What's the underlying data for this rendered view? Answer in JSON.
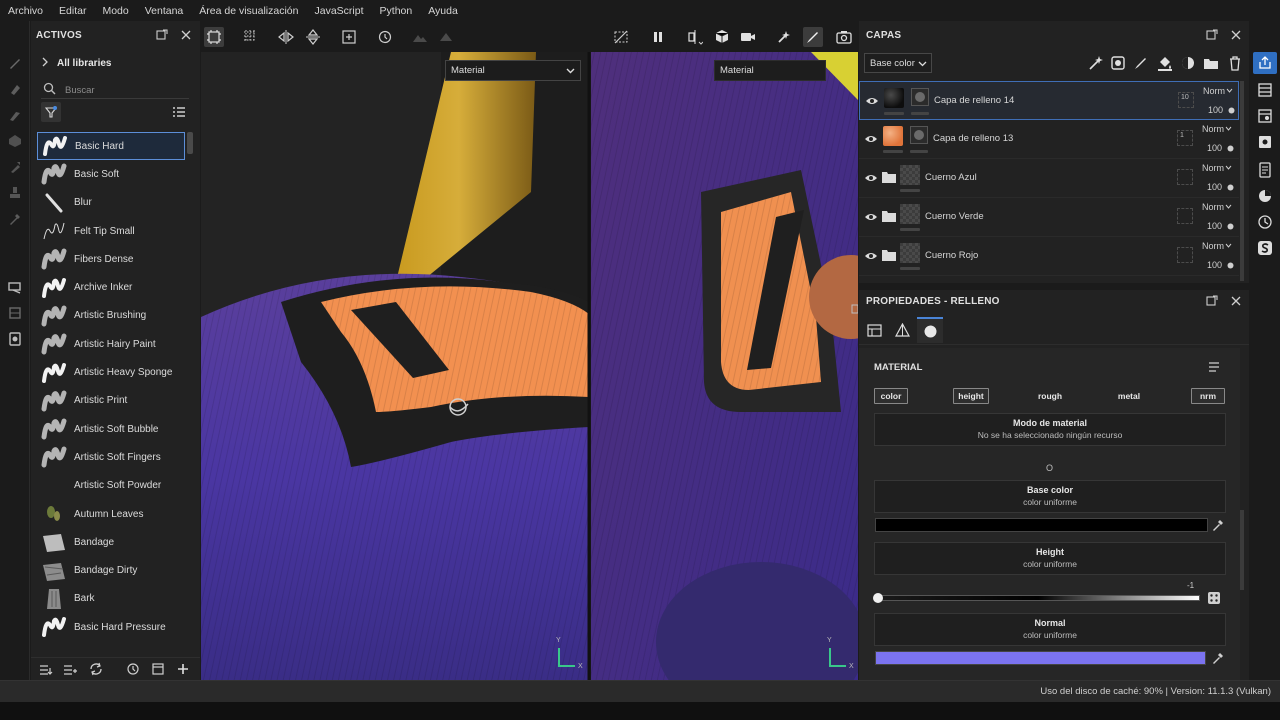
{
  "menu": [
    "Archivo",
    "Editar",
    "Modo",
    "Ventana",
    "Área de visualización",
    "JavaScript",
    "Python",
    "Ayuda"
  ],
  "assets": {
    "title": "ACTIVOS",
    "libraries_label": "All libraries",
    "search_placeholder": "Buscar",
    "brushes": [
      "Basic Hard",
      "Basic Soft",
      "Blur",
      "Felt Tip Small",
      "Fibers Dense",
      "Archive Inker",
      "Artistic Brushing",
      "Artistic Hairy Paint",
      "Artistic Heavy Sponge",
      "Artistic Print",
      "Artistic Soft Bubble",
      "Artistic Soft Fingers",
      "Artistic Soft Powder",
      "Autumn Leaves",
      "Bandage",
      "Bandage Dirty",
      "Bark",
      "Basic Hard Pressure"
    ],
    "selected_brush": "Basic Hard"
  },
  "viewport": {
    "left_material": "Material",
    "right_material": "Material",
    "axis_y": "Y",
    "axis_x": "X"
  },
  "layers": {
    "title": "CAPAS",
    "blend_select": "Base color",
    "items": [
      {
        "name": "Capa de relleno 14",
        "blend": "Norm",
        "opacity": "100",
        "mini": "10",
        "type": "fill",
        "thumb_color": "#0d0d0d",
        "selected": true
      },
      {
        "name": "Capa de relleno 13",
        "blend": "Norm",
        "opacity": "100",
        "mini": "1",
        "type": "fill",
        "thumb_color": "#e0743a",
        "selected": false
      },
      {
        "name": "Cuerno Azul",
        "blend": "Norm",
        "opacity": "100",
        "mini": "",
        "type": "folder"
      },
      {
        "name": "Cuerno Verde",
        "blend": "Norm",
        "opacity": "100",
        "mini": "",
        "type": "folder"
      },
      {
        "name": "Cuerno Rojo",
        "blend": "Norm",
        "opacity": "100",
        "mini": "",
        "type": "folder"
      }
    ]
  },
  "properties": {
    "title": "PROPIEDADES - RELLENO",
    "section": "MATERIAL",
    "channels": [
      {
        "label": "color",
        "on": true
      },
      {
        "label": "height",
        "on": true
      },
      {
        "label": "rough",
        "on": false
      },
      {
        "label": "metal",
        "on": false
      },
      {
        "label": "nrm",
        "on": true
      }
    ],
    "material_mode_title": "Modo de material",
    "material_mode_value": "No se ha seleccionado ningún recurso",
    "separator": "O",
    "base_color_title": "Base color",
    "base_color_sub": "color uniforme",
    "base_color_value": "#000000",
    "height_title": "Height",
    "height_sub": "color uniforme",
    "height_value": "-1",
    "height_slider_fraction": 0,
    "normal_title": "Normal",
    "normal_sub": "color uniforme",
    "normal_value": "#7b73f0"
  },
  "status": {
    "text": "Uso del disco de caché:  90% | Version: 11.1.3 (Vulkan)"
  }
}
